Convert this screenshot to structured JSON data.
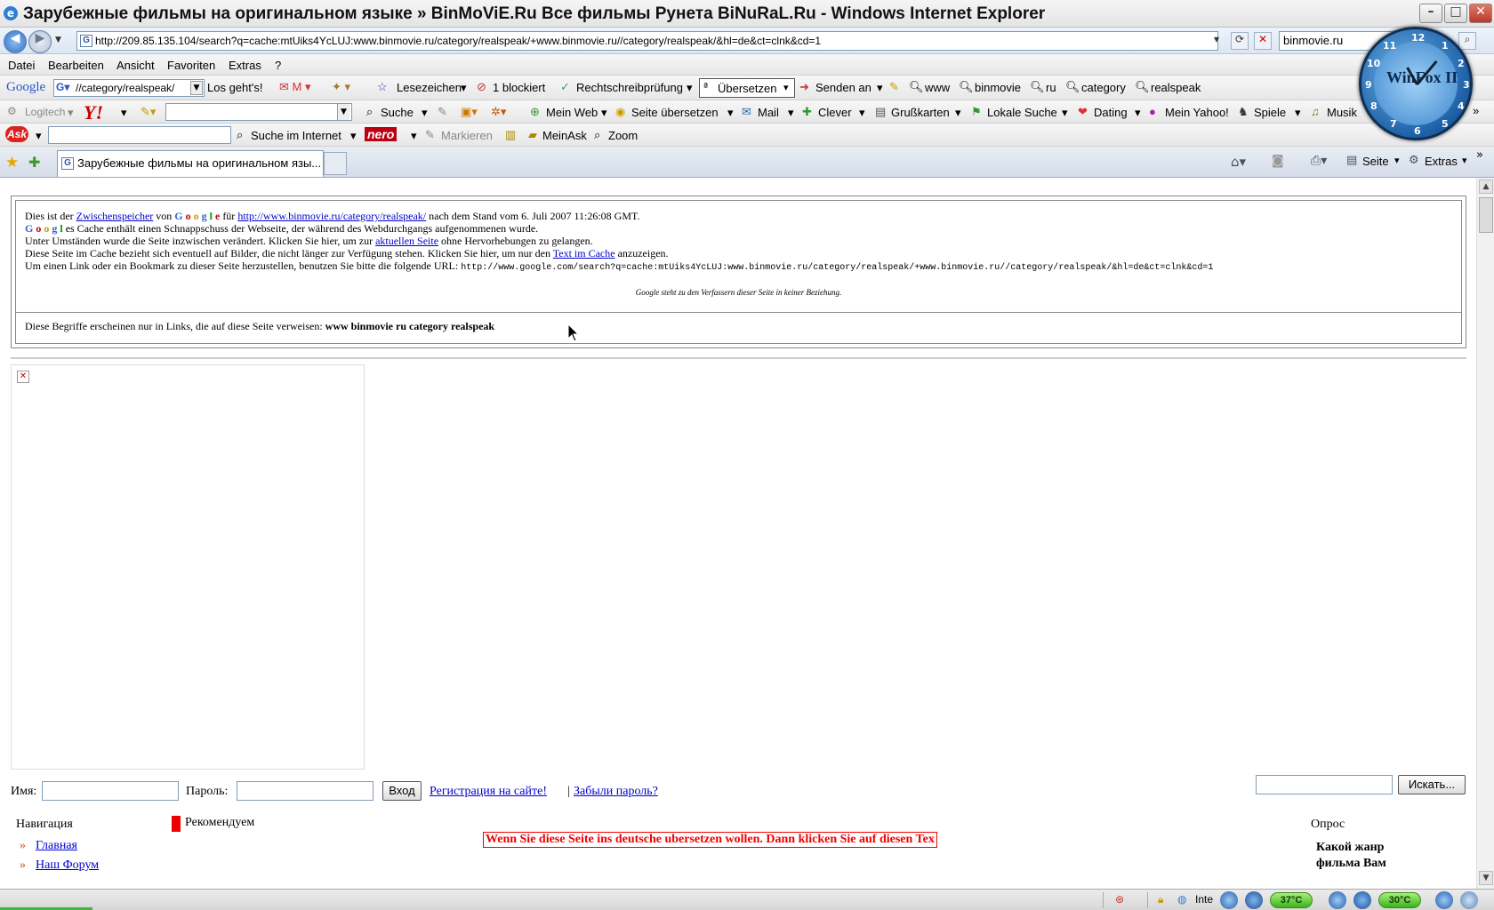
{
  "window": {
    "title": "Зарубежные фильмы на оригинальном языке » BinMoViE.Ru Все фильмы Рунета BiNuRaL.Ru - Windows Internet Explorer",
    "buttons": {
      "minimize": "–",
      "maximize": "□",
      "close": "✕"
    }
  },
  "address": {
    "url": "http://209.85.135.104/search?q=cache:mtUiks4YcLUJ:www.binmovie.ru/category/realspeak/+www.binmovie.ru//category/realspeak/&hl=de&ct=clnk&cd=1",
    "search_value": "binmovie.ru"
  },
  "menu": [
    "Datei",
    "Bearbeiten",
    "Ansicht",
    "Favoriten",
    "Extras",
    "?"
  ],
  "google_toolbar": {
    "logo": "Google",
    "query": "//category/realspeak/",
    "go": "Los geht's!",
    "lesezeichen": "Lesezeichen",
    "blocked": "1 blockiert",
    "spell": "Rechtschreibprüfung",
    "translate": "Übersetzen",
    "send": "Senden an",
    "terms": [
      "www",
      "binmovie",
      "ru",
      "category",
      "realspeak"
    ]
  },
  "yahoo_toolbar": {
    "logitech": "Logitech",
    "search": "Suche",
    "items": [
      "Mein Web",
      "Seite übersetzen",
      "Mail",
      "Clever",
      "Grußkarten",
      "Lokale Suche",
      "Dating",
      "Mein Yahoo!",
      "Spiele",
      "Musik"
    ]
  },
  "ask_toolbar": {
    "search_internet": "Suche im Internet",
    "nero": "nero",
    "mark": "Markieren",
    "myask": "MeinAsk",
    "zoom": "Zoom"
  },
  "tabs": {
    "active": "Зарубежные фильмы на оригинальном язы...",
    "tools": {
      "page": "Seite",
      "extras": "Extras"
    }
  },
  "cache": {
    "l1_a": "Dies ist der ",
    "l1_link1": "Zwischenspeicher",
    "l1_b": " von ",
    "l1_c": " für ",
    "l1_link2": "http://www.binmovie.ru/category/realspeak/",
    "l1_d": " nach dem Stand vom 6. Juli 2007 11:26:08 GMT.",
    "l2": "es Cache enthält einen Schnappschuss der Webseite, der während des Webdurchgangs aufgenommenen wurde.",
    "l3_a": "Unter Umständen wurde die Seite inzwischen verändert. Klicken Sie hier, um zur ",
    "l3_link": "aktuellen Seite",
    "l3_b": " ohne Hervorhebungen zu gelangen.",
    "l4_a": "Diese Seite im Cache bezieht sich eventuell auf Bilder, die nicht länger zur Verfügung stehen. Klicken Sie hier, um nur den ",
    "l4_link": "Text im Cache",
    "l4_b": " anzuzeigen.",
    "l5_a": "Um einen Link oder ein Bookmark zu dieser Seite herzustellen, benutzen Sie bitte die folgende URL: ",
    "l5_url": "http://www.google.com/search?q=cache:mtUiks4YcLUJ:www.binmovie.ru/category/realspeak/+www.binmovie.ru//category/realspeak/&hl=de&ct=clnk&cd=1",
    "disclaimer": "Google steht zu den Verfassern dieser Seite in keiner Beziehung.",
    "terms_a": "Diese Begriffe erscheinen nur in Links, die auf diese Seite verweisen: ",
    "terms_b": "www binmovie ru category realspeak"
  },
  "site": {
    "name_label": "Имя:",
    "password_label": "Пароль:",
    "login_button": "Вход",
    "register_link": "Регистрация на сайте!",
    "separator": "|",
    "forgot_link": "Забыли пароль?",
    "search_button": "Искать...",
    "nav_title": "Навигация",
    "nav_items": [
      "Главная",
      "Наш Форум"
    ],
    "recommend": "Рекомендуем",
    "translate_notice": "Wenn Sie diese Seite ins deutsche ubersetzen wollen. Dann klicken Sie auf diesen Tex",
    "poll_title": "Опрос",
    "poll_question_1": "Какой жанр",
    "poll_question_2": "фильма Вам"
  },
  "status": {
    "zone": "Inte",
    "temp1": "37°C",
    "temp2": "30°C"
  },
  "clock": {
    "brand": "WinFox II",
    "numbers": [
      "12",
      "1",
      "2",
      "3",
      "4",
      "5",
      "6",
      "7",
      "8",
      "9",
      "10",
      "11"
    ]
  },
  "colors": {
    "link": "#0000cc",
    "accent_red": "#e00000",
    "ie_blue": "#2d7fd3"
  }
}
